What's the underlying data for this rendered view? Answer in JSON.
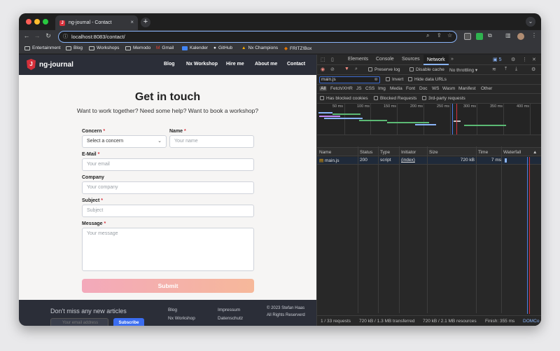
{
  "browser": {
    "tab_title": "ng-journal - Contact",
    "tab_favicon": "J",
    "tab_close": "×",
    "new_tab": "+",
    "tab_list": "⌄",
    "url": "localhost:8083/contact/",
    "bookmarks": [
      "Entertainment",
      "Blog",
      "Workshops",
      "Memodo",
      "Gmail",
      "Kalender",
      "GitHub",
      "Nx Champions",
      "FRITZ!Box"
    ]
  },
  "site": {
    "brand": "ng-journal",
    "logo_letter": "J",
    "nav": [
      "Blog",
      "Nx Workshop",
      "Hire me",
      "About me",
      "Contact"
    ],
    "title": "Get in touch",
    "subtitle": "Want to work together? Need some help? Want to book a workshop?",
    "required_mark": "*",
    "form": {
      "concern_label": "Concern",
      "concern_value": "Select a concern",
      "name_label": "Name",
      "name_placeholder": "Your name",
      "email_label": "E-Mail",
      "email_placeholder": "Your email",
      "company_label": "Company",
      "company_placeholder": "Your company",
      "subject_label": "Subject",
      "subject_placeholder": "Subject",
      "message_label": "Message",
      "message_placeholder": "Your message",
      "submit_label": "Submit"
    },
    "footer": {
      "newsletter_heading": "Don't miss any new articles",
      "email_placeholder": "Your email address",
      "subscribe_label": "Subscribe",
      "links_col1": [
        "Blog",
        "Nx Workshop"
      ],
      "links_col2": [
        "Impressum",
        "Datenschutz"
      ],
      "copyright": "© 2023 Stefan Haas",
      "rights": "All Rights Reserverd"
    }
  },
  "devtools": {
    "tabs": [
      "Elements",
      "Console",
      "Sources",
      "Network"
    ],
    "issues_count": "5",
    "filter_value": "main.js",
    "preserve_log": "Preserve log",
    "disable_cache": "Disable cache",
    "throttling": "No throttling",
    "invert": "Invert",
    "hide_data_urls": "Hide data URLs",
    "type_filters": [
      "All",
      "Fetch/XHR",
      "JS",
      "CSS",
      "Img",
      "Media",
      "Font",
      "Doc",
      "WS",
      "Wasm",
      "Manifest",
      "Other"
    ],
    "has_blocked_cookies": "Has blocked cookies",
    "blocked_requests": "Blocked Requests",
    "third_party": "3rd-party requests",
    "timeline_ticks": [
      "50 ms",
      "100 ms",
      "150 ms",
      "200 ms",
      "250 ms",
      "300 ms",
      "350 ms",
      "400 ms"
    ],
    "columns": [
      "Name",
      "Status",
      "Type",
      "Initiator",
      "Size",
      "Time",
      "Waterfall"
    ],
    "rows": [
      {
        "name": "main.js",
        "status": "200",
        "type": "script",
        "initiator": "(index)",
        "size": "720 kB",
        "time": "7 ms"
      }
    ],
    "status_bar": {
      "requests": "1 / 33 requests",
      "transferred": "720 kB / 1.3 MB transferred",
      "resources": "720 kB / 2.1 MB resources",
      "finish": "Finish: 355 ms",
      "domcontent": "DOMCo"
    }
  },
  "colors": {
    "accent": "#d6303b",
    "devtools_active": "#8ab4f8",
    "submit_gradient_start": "#f3a9bb",
    "submit_gradient_end": "#f6b89a"
  }
}
